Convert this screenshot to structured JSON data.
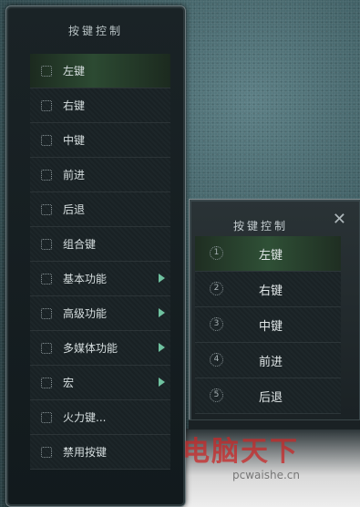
{
  "left_panel": {
    "title": "按键控制",
    "items": [
      {
        "label": "左键",
        "active": true,
        "has_submenu": false
      },
      {
        "label": "右键",
        "active": false,
        "has_submenu": false
      },
      {
        "label": "中键",
        "active": false,
        "has_submenu": false
      },
      {
        "label": "前进",
        "active": false,
        "has_submenu": false
      },
      {
        "label": "后退",
        "active": false,
        "has_submenu": false
      },
      {
        "label": "组合键",
        "active": false,
        "has_submenu": false
      },
      {
        "label": "基本功能",
        "active": false,
        "has_submenu": true
      },
      {
        "label": "高级功能",
        "active": false,
        "has_submenu": true
      },
      {
        "label": "多媒体功能",
        "active": false,
        "has_submenu": true
      },
      {
        "label": "宏",
        "active": false,
        "has_submenu": true
      },
      {
        "label": "火力键...",
        "active": false,
        "has_submenu": false
      },
      {
        "label": "禁用按键",
        "active": false,
        "has_submenu": false
      }
    ]
  },
  "right_panel": {
    "title": "按键控制",
    "close_label": "✕",
    "items": [
      {
        "num": "1",
        "label": "左键",
        "active": true
      },
      {
        "num": "2",
        "label": "右键",
        "active": false
      },
      {
        "num": "3",
        "label": "中键",
        "active": false
      },
      {
        "num": "4",
        "label": "前进",
        "active": false
      },
      {
        "num": "5",
        "label": "后退",
        "active": false
      }
    ]
  },
  "watermark": {
    "text": "电脑天下",
    "url": "pcwaishe.cn"
  }
}
